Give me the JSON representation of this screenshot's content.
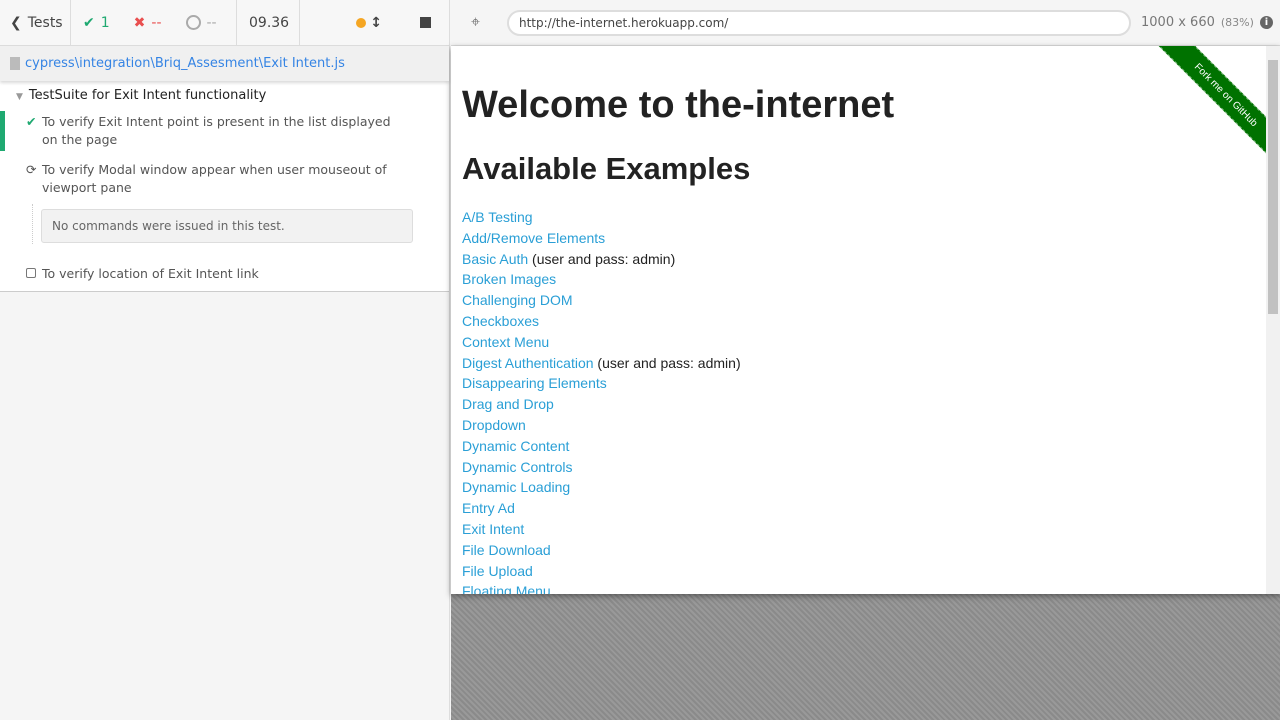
{
  "reporter": {
    "back_label": "Tests",
    "passed": "1",
    "failed": "--",
    "pending": "--",
    "duration": "09.36",
    "file_path": "cypress\\integration\\Briq_Assesment\\Exit Intent.js",
    "suite": "TestSuite for Exit Intent functionality",
    "tests": [
      {
        "title": "To verify Exit Intent point is present in the list displayed on the page",
        "state": "passed"
      },
      {
        "title": "To verify Modal window appear when user mouseout of viewport pane",
        "state": "running"
      },
      {
        "title": "To verify location of Exit Intent link",
        "state": "pending"
      }
    ],
    "no_commands": "No commands were issued in this test."
  },
  "browser": {
    "url": "http://the-internet.herokuapp.com/",
    "viewport": "1000 x 660",
    "scale": "(83%)"
  },
  "page": {
    "h1": "Welcome to the-internet",
    "h2": "Available Examples",
    "ribbon": "Fork me on GitHub",
    "links": [
      {
        "text": "A/B Testing"
      },
      {
        "text": "Add/Remove Elements"
      },
      {
        "text": "Basic Auth",
        "note": " (user and pass: admin)"
      },
      {
        "text": "Broken Images"
      },
      {
        "text": "Challenging DOM"
      },
      {
        "text": "Checkboxes"
      },
      {
        "text": "Context Menu"
      },
      {
        "text": "Digest Authentication",
        "note": " (user and pass: admin)"
      },
      {
        "text": "Disappearing Elements"
      },
      {
        "text": "Drag and Drop"
      },
      {
        "text": "Dropdown"
      },
      {
        "text": "Dynamic Content"
      },
      {
        "text": "Dynamic Controls"
      },
      {
        "text": "Dynamic Loading"
      },
      {
        "text": "Entry Ad"
      },
      {
        "text": "Exit Intent"
      },
      {
        "text": "File Download"
      },
      {
        "text": "File Upload"
      },
      {
        "text": "Floating Menu"
      }
    ]
  },
  "colors": {
    "pass": "#1fa971",
    "fail": "#e94f4f",
    "link": "#2a9fd6",
    "ribbon": "#007200",
    "running": "#f5a623"
  }
}
